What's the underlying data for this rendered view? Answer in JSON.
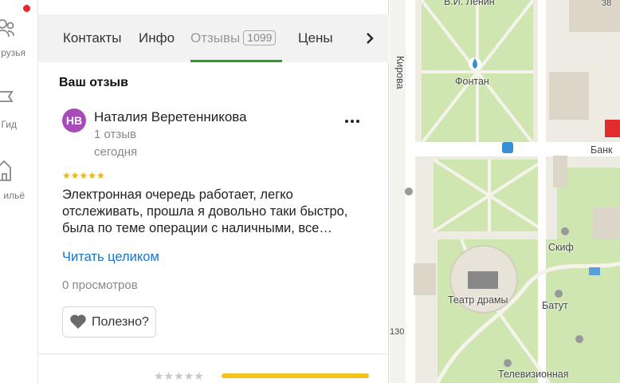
{
  "nav": {
    "items": [
      {
        "label": "рузья",
        "icon": "friends-icon"
      },
      {
        "label": "Гид",
        "icon": "flag-icon"
      },
      {
        "label": "ильё",
        "icon": "housing-icon"
      }
    ],
    "notification_color": "#e8262b"
  },
  "tabs": {
    "items": [
      {
        "label": "Контакты"
      },
      {
        "label": "Инфо"
      },
      {
        "label": "Отзывы",
        "count": "1099",
        "active": true
      },
      {
        "label": "Цены"
      }
    ],
    "next_icon": "chevron-right-icon",
    "active_color": "#2e9a2e"
  },
  "review": {
    "section_title": "Ваш отзыв",
    "avatar_initials": "НВ",
    "avatar_color": "#a64bb8",
    "author": "Наталия Веретенникова",
    "review_count": "1 отзыв",
    "date": "сегодня",
    "rating": 5,
    "stars": "★★★★★",
    "text": "Электронная очередь работает, легко отслеживать, прошла я довольно таки быстро, была по теме операции с наличными, все…",
    "read_more": "Читать целиком",
    "views": "0 просмотров",
    "helpful_label": "Полезно?"
  },
  "rating_summary": {
    "stars": "★★★★★",
    "bar_color": "#f2c31f"
  },
  "map": {
    "labels": {
      "lenin": "В.И. Ленин",
      "kirova": "Кирова",
      "fountain": "Фонтан",
      "bank": "Банк",
      "skif": "Скиф",
      "theatre": "Театр драмы",
      "batut": "Батут",
      "tv": "Телевизионная",
      "n38": "38",
      "n130": "130"
    }
  }
}
